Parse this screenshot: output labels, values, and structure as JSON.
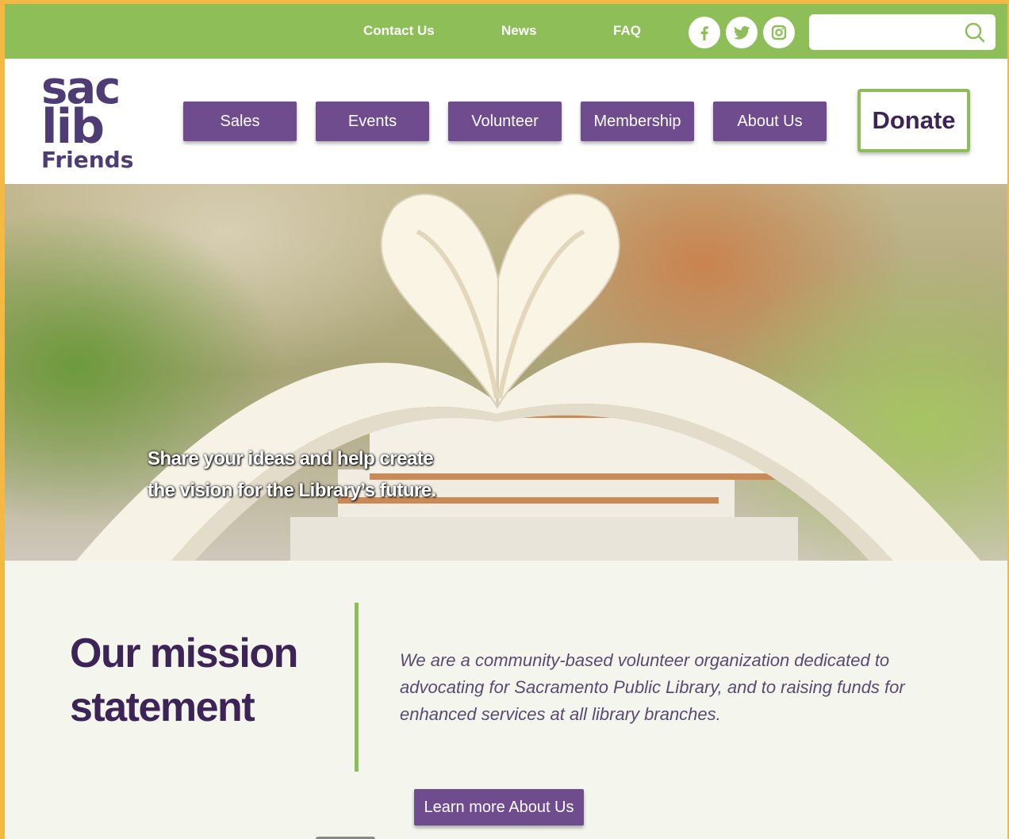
{
  "topbar": {
    "links": [
      "Contact Us",
      "News",
      "FAQ"
    ],
    "social": [
      "facebook-icon",
      "twitter-icon",
      "instagram-icon"
    ],
    "search": {
      "placeholder": "",
      "value": ""
    },
    "color": "#8dbe57"
  },
  "logo": {
    "line1": "sac",
    "line2": "lib",
    "line3": "Friends"
  },
  "nav": {
    "items": [
      "Sales",
      "Events",
      "Volunteer",
      "Membership",
      "About Us"
    ],
    "donate": "Donate"
  },
  "hero": {
    "line1": "Share your ideas and help create",
    "line2": "the vision for the Library’s future."
  },
  "mission": {
    "title_line1": "Our mission",
    "title_line2": "statement",
    "text": "We are a community-based volunteer organization dedicated to advocating for Sacramento Public Library, and to raising funds for enhanced services at all library branches.",
    "button": "Learn more About Us"
  },
  "colors": {
    "purple": "#6e4c8e",
    "dark_purple": "#3c2556",
    "green": "#8dbe57",
    "frame": "#f4b942"
  }
}
